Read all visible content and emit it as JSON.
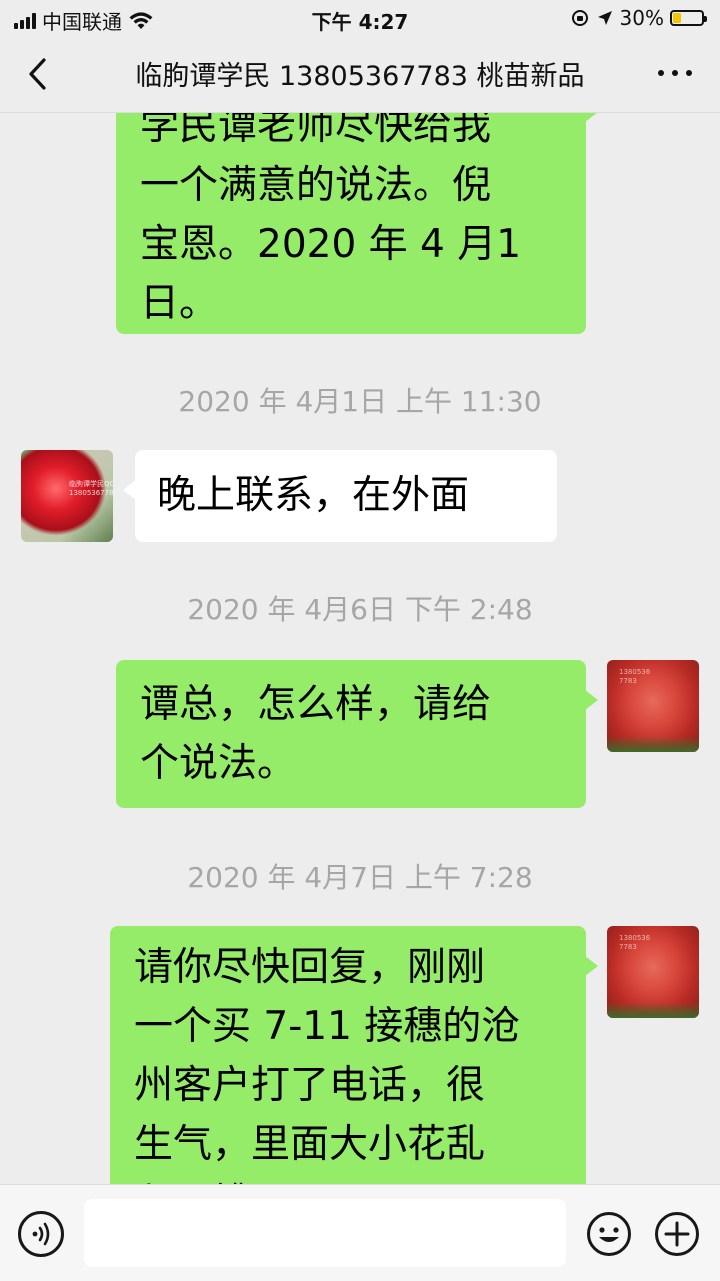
{
  "status_bar": {
    "carrier": "中国联通",
    "time": "下午 4:27",
    "battery": "30%",
    "battery_level": 0.3
  },
  "nav": {
    "title": "临朐谭学民 13805367783 桃苗新品",
    "back_icon": "chevron-left-icon",
    "more_icon": "more-dots-icon"
  },
  "messages": [
    {
      "side": "out",
      "lines": [
        "学民谭老师尽快给我",
        "一个满意的说法。倪",
        "宝恩。2020 年 4 月1",
        "日。"
      ]
    },
    {
      "timestamp": "2020 年 4月1日 上午 11:30"
    },
    {
      "side": "in",
      "lines": [
        "晚上联系，在外面"
      ]
    },
    {
      "timestamp": "2020 年 4月6日 下午 2:48"
    },
    {
      "side": "out",
      "lines": [
        "谭总，怎么样，请给",
        "个说法。"
      ]
    },
    {
      "timestamp": "2020 年 4月7日 上午 7:28"
    },
    {
      "side": "out",
      "lines": [
        "请你尽快回复，刚刚",
        "一个买 7-11 接穗的沧",
        "州客户打了电话，很",
        "生气，里面大小花乱",
        "七八糟"
      ]
    }
  ],
  "avatars": {
    "peer_watermark": "临朐谭学民QQ 13805367783",
    "self_watermark": "1380536 7783"
  },
  "input_bar": {
    "voice_icon": "voice-icon",
    "emoji_icon": "emoji-icon",
    "plus_icon": "plus-icon",
    "placeholder": ""
  },
  "colors": {
    "background": "#ededed",
    "outgoing_bubble": "#95ec69",
    "incoming_bubble": "#ffffff",
    "timestamp": "#a6a6a6"
  }
}
